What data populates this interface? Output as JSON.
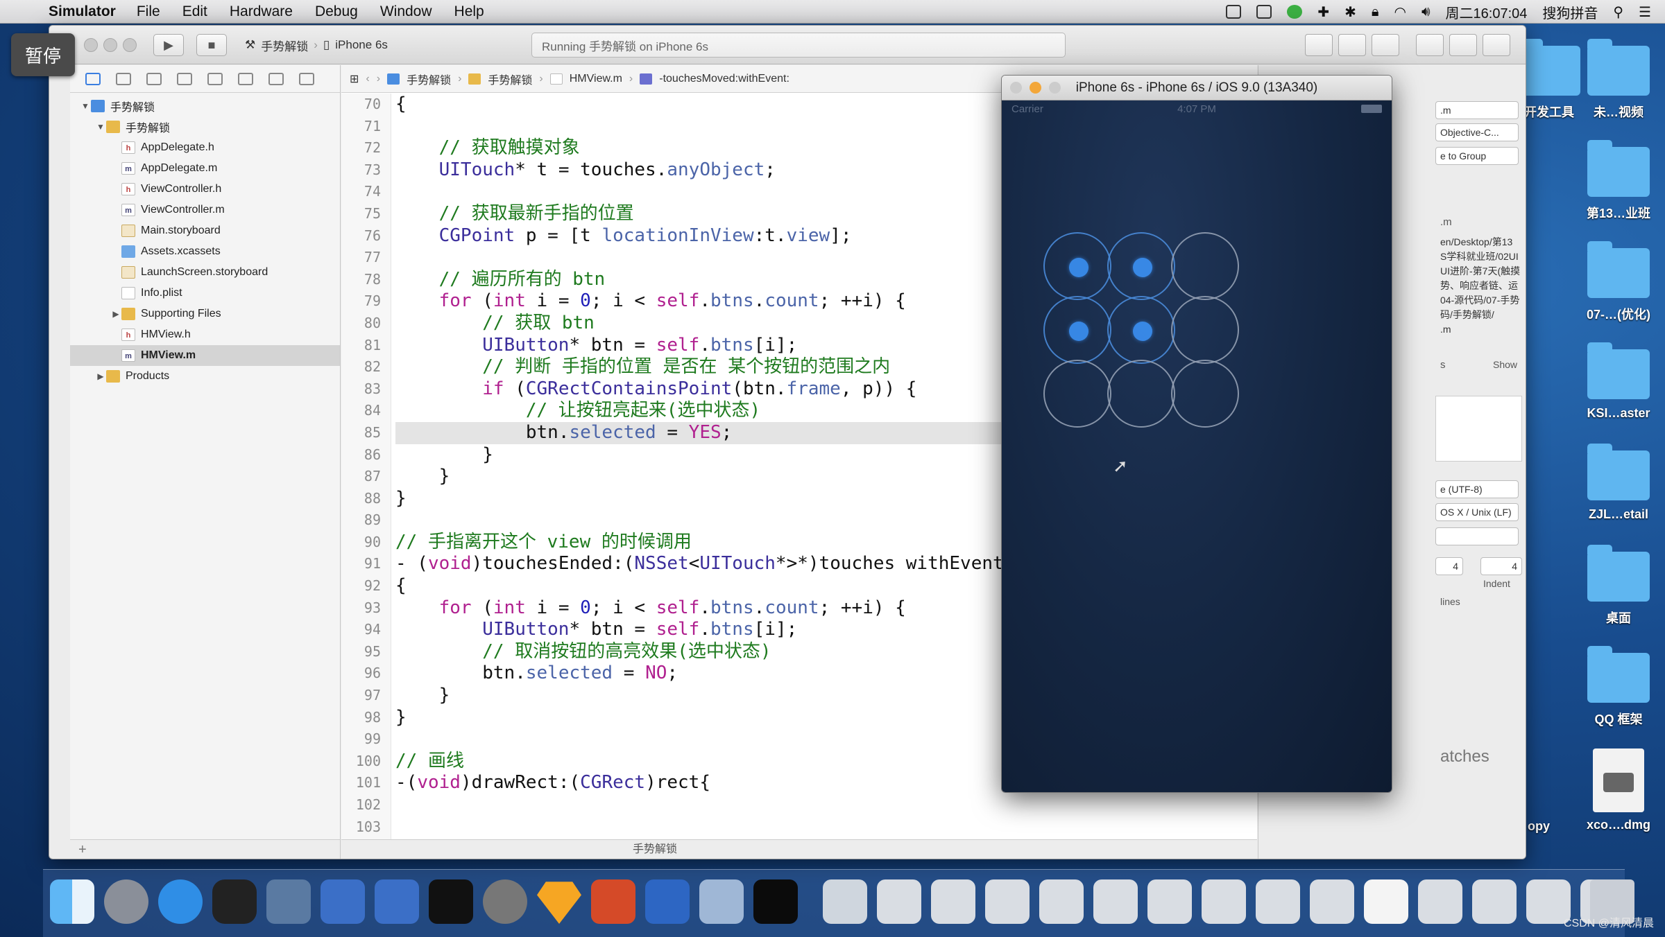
{
  "menubar": {
    "app_name": "Simulator",
    "menus": [
      "File",
      "Edit",
      "Hardware",
      "Debug",
      "Window",
      "Help"
    ],
    "clock": "周二16:07:04",
    "input_method": "搜狗拼音"
  },
  "pause_badge": "暂停",
  "xcode": {
    "scheme_target": "手势解锁",
    "scheme_device": "iPhone 6s",
    "status": "Running 手势解锁 on iPhone 6s",
    "jumpbar": [
      "手势解锁",
      "手势解锁",
      "HMView.m",
      "-touchesMoved:withEvent:"
    ],
    "navigator": [
      {
        "label": "手势解锁",
        "type": "project",
        "level": 0,
        "disclosure": "open"
      },
      {
        "label": "手势解锁",
        "type": "folder",
        "level": 1,
        "disclosure": "open"
      },
      {
        "label": "AppDelegate.h",
        "type": "h",
        "level": 2
      },
      {
        "label": "AppDelegate.m",
        "type": "m",
        "level": 2
      },
      {
        "label": "ViewController.h",
        "type": "h",
        "level": 2
      },
      {
        "label": "ViewController.m",
        "type": "m",
        "level": 2
      },
      {
        "label": "Main.storyboard",
        "type": "sb",
        "level": 2
      },
      {
        "label": "Assets.xcassets",
        "type": "assets",
        "level": 2
      },
      {
        "label": "LaunchScreen.storyboard",
        "type": "sb",
        "level": 2
      },
      {
        "label": "Info.plist",
        "type": "plist",
        "level": 2
      },
      {
        "label": "Supporting Files",
        "type": "folder",
        "level": 2,
        "disclosure": "closed"
      },
      {
        "label": "HMView.h",
        "type": "h",
        "level": 2
      },
      {
        "label": "HMView.m",
        "type": "m",
        "level": 2,
        "selected": true
      },
      {
        "label": "Products",
        "type": "folder",
        "level": 1,
        "disclosure": "closed"
      }
    ],
    "line_numbers": [
      "70",
      "71",
      "72",
      "73",
      "74",
      "75",
      "76",
      "77",
      "78",
      "79",
      "80",
      "81",
      "82",
      "83",
      "84",
      "85",
      "86",
      "87",
      "88",
      "89",
      "90",
      "91",
      "92",
      "93",
      "94",
      "95",
      "96",
      "97",
      "98",
      "99",
      "100",
      "101",
      "102",
      "103"
    ],
    "code_lines": [
      "{",
      "",
      "    // 获取触摸对象",
      "    UITouch* t = touches.anyObject;",
      "",
      "    // 获取最新手指的位置",
      "    CGPoint p = [t locationInView:t.view];",
      "",
      "    // 遍历所有的 btn",
      "    for (int i = 0; i < self.btns.count; ++i) {",
      "        // 获取 btn",
      "        UIButton* btn = self.btns[i];",
      "        // 判断 手指的位置 是否在 某个按钮的范围之内",
      "        if (CGRectContainsPoint(btn.frame, p)) {",
      "            // 让按钮亮起来(选中状态)",
      "            btn.selected = YES;",
      "        }",
      "    }",
      "}",
      "",
      "// 手指离开这个 view 的时候调用",
      "- (void)touchesEnded:(NSSet<UITouch*>*)touches withEvent",
      "{",
      "    for (int i = 0; i < self.btns.count; ++i) {",
      "        UIButton* btn = self.btns[i];",
      "        // 取消按钮的高亮效果(选中状态)",
      "        btn.selected = NO;",
      "    }",
      "}",
      "",
      "// 画线",
      "-(void)drawRect:(CGRect)rect{",
      "",
      ""
    ],
    "highlighted_line_index": 15,
    "editor_bottom_target": "手势解锁",
    "utilities": {
      "name_field": ".m",
      "file_type": "Objective-C...",
      "location": "e to Group",
      "full_path_label": ".m",
      "full_path": "en/Desktop/第13\nS学科就业班/02UI\nUI进阶-第7天(触摸\n势、响应者链、运\n04-源代码/07-手势\n码/手势解锁/\n.m",
      "section_label": "s",
      "show_label": "Show",
      "encoding": "e (UTF-8)",
      "line_endings": "OS X / Unix (LF)",
      "tab_value": "4",
      "indent_value": "4",
      "indent_label": "Indent",
      "lines_label": "lines",
      "matches_label": "atches"
    }
  },
  "simulator": {
    "title": "iPhone 6s - iPhone 6s / iOS 9.0 (13A340)",
    "carrier": "Carrier",
    "time": "4:07 PM",
    "grid_selected": [
      true,
      true,
      false,
      true,
      true,
      false,
      false,
      false,
      false
    ]
  },
  "desktop_items": [
    {
      "label": "开发工具",
      "icon": "folder-icon"
    },
    {
      "label": "未…视频",
      "icon": "folder-icon"
    },
    {
      "label": "第13…业班",
      "icon": "folder-icon"
    },
    {
      "label": "07-…(优化)",
      "icon": "folder-icon"
    },
    {
      "label": "KSI…aster",
      "icon": "folder-icon"
    },
    {
      "label": "ZJL…etail",
      "icon": "folder-icon"
    },
    {
      "label": "桌面",
      "icon": "folder-icon"
    },
    {
      "label": "QQ 框架",
      "icon": "folder-icon"
    },
    {
      "label": "xco….dmg",
      "icon": "disk-image-icon"
    },
    {
      "label": "opy",
      "icon": "folder-icon"
    }
  ],
  "dock": [
    "Finder",
    "Launchpad",
    "Safari",
    "Mouse",
    "Photo Slideshow",
    "Xcode",
    "Xcode Tools",
    "Terminal",
    "System Preferences",
    "Sketch",
    "PowerPoint",
    "Other App",
    "Screenshot",
    "Console",
    "QuickTime",
    "Window 1",
    "Window 2",
    "Window 3",
    "Window 4",
    "Window 5",
    "Window 6",
    "Window 7",
    "Window 8",
    "Window 9",
    "Window 10",
    "Window 11",
    "Window 12",
    "Window 13",
    "Window 14",
    "Trash"
  ],
  "watermark": "CSDN @清风清晨"
}
